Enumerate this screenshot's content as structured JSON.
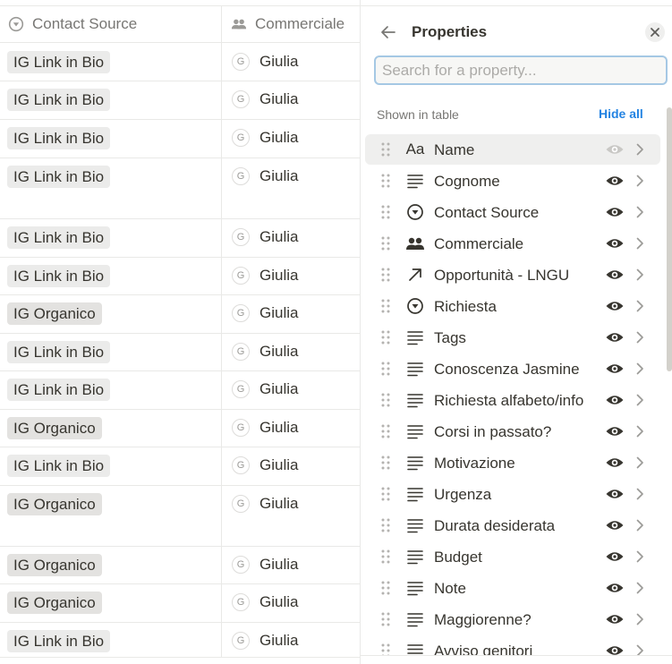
{
  "table": {
    "columns": [
      {
        "label": "Contact Source",
        "icon": "select-icon"
      },
      {
        "label": "Commerciale",
        "icon": "people-icon"
      }
    ],
    "rows": [
      {
        "source": "IG Link in Bio",
        "kind": "bio",
        "avatar": "G",
        "person": "Giulia"
      },
      {
        "source": "IG Link in Bio",
        "kind": "bio",
        "avatar": "G",
        "person": "Giulia"
      },
      {
        "source": "IG Link in Bio",
        "kind": "bio",
        "avatar": "G",
        "person": "Giulia"
      },
      {
        "source": "IG Link in Bio",
        "kind": "bio",
        "avatar": "G",
        "person": "Giulia"
      },
      {
        "source": "IG Link in Bio",
        "kind": "bio",
        "avatar": "G",
        "person": "Giulia"
      },
      {
        "source": "IG Link in Bio",
        "kind": "bio",
        "avatar": "G",
        "person": "Giulia"
      },
      {
        "source": "IG Organico",
        "kind": "org",
        "avatar": "G",
        "person": "Giulia"
      },
      {
        "source": "IG Link in Bio",
        "kind": "bio",
        "avatar": "G",
        "person": "Giulia"
      },
      {
        "source": "IG Link in Bio",
        "kind": "bio",
        "avatar": "G",
        "person": "Giulia"
      },
      {
        "source": "IG Organico",
        "kind": "org",
        "avatar": "G",
        "person": "Giulia"
      },
      {
        "source": "IG Link in Bio",
        "kind": "bio",
        "avatar": "G",
        "person": "Giulia"
      },
      {
        "source": "IG Organico",
        "kind": "org",
        "avatar": "G",
        "person": "Giulia"
      },
      {
        "source": "IG Organico",
        "kind": "org",
        "avatar": "G",
        "person": "Giulia"
      },
      {
        "source": "IG Organico",
        "kind": "org",
        "avatar": "G",
        "person": "Giulia"
      },
      {
        "source": "IG Link in Bio",
        "kind": "bio",
        "avatar": "G",
        "person": "Giulia"
      }
    ]
  },
  "panel": {
    "title": "Properties",
    "back_icon": "arrow-left-icon",
    "close_icon": "close-icon",
    "search_placeholder": "Search for a property...",
    "section_label": "Shown in table",
    "hide_all_label": "Hide all",
    "accent_color": "#2383e2",
    "properties": [
      {
        "name": "Name",
        "type_icon": "title-icon",
        "visible": true
      },
      {
        "name": "Cognome",
        "type_icon": "text-icon",
        "visible": true
      },
      {
        "name": "Contact Source",
        "type_icon": "select-icon",
        "visible": true
      },
      {
        "name": "Commerciale",
        "type_icon": "people-icon",
        "visible": true
      },
      {
        "name": "Opportunità - LNGU",
        "type_icon": "relation-icon",
        "visible": true
      },
      {
        "name": "Richiesta",
        "type_icon": "select-icon",
        "visible": true
      },
      {
        "name": "Tags",
        "type_icon": "text-icon",
        "visible": true
      },
      {
        "name": "Conoscenza Jasmine",
        "type_icon": "text-icon",
        "visible": true
      },
      {
        "name": "Richiesta alfabeto/info",
        "type_icon": "text-icon",
        "visible": true
      },
      {
        "name": "Corsi in passato?",
        "type_icon": "text-icon",
        "visible": true
      },
      {
        "name": "Motivazione",
        "type_icon": "text-icon",
        "visible": true
      },
      {
        "name": "Urgenza",
        "type_icon": "text-icon",
        "visible": true
      },
      {
        "name": "Durata desiderata",
        "type_icon": "text-icon",
        "visible": true
      },
      {
        "name": "Budget",
        "type_icon": "text-icon",
        "visible": true
      },
      {
        "name": "Note",
        "type_icon": "text-icon",
        "visible": true
      },
      {
        "name": "Maggiorenne?",
        "type_icon": "text-icon",
        "visible": true
      },
      {
        "name": "Avviso genitori",
        "type_icon": "text-icon",
        "visible": true
      }
    ]
  }
}
